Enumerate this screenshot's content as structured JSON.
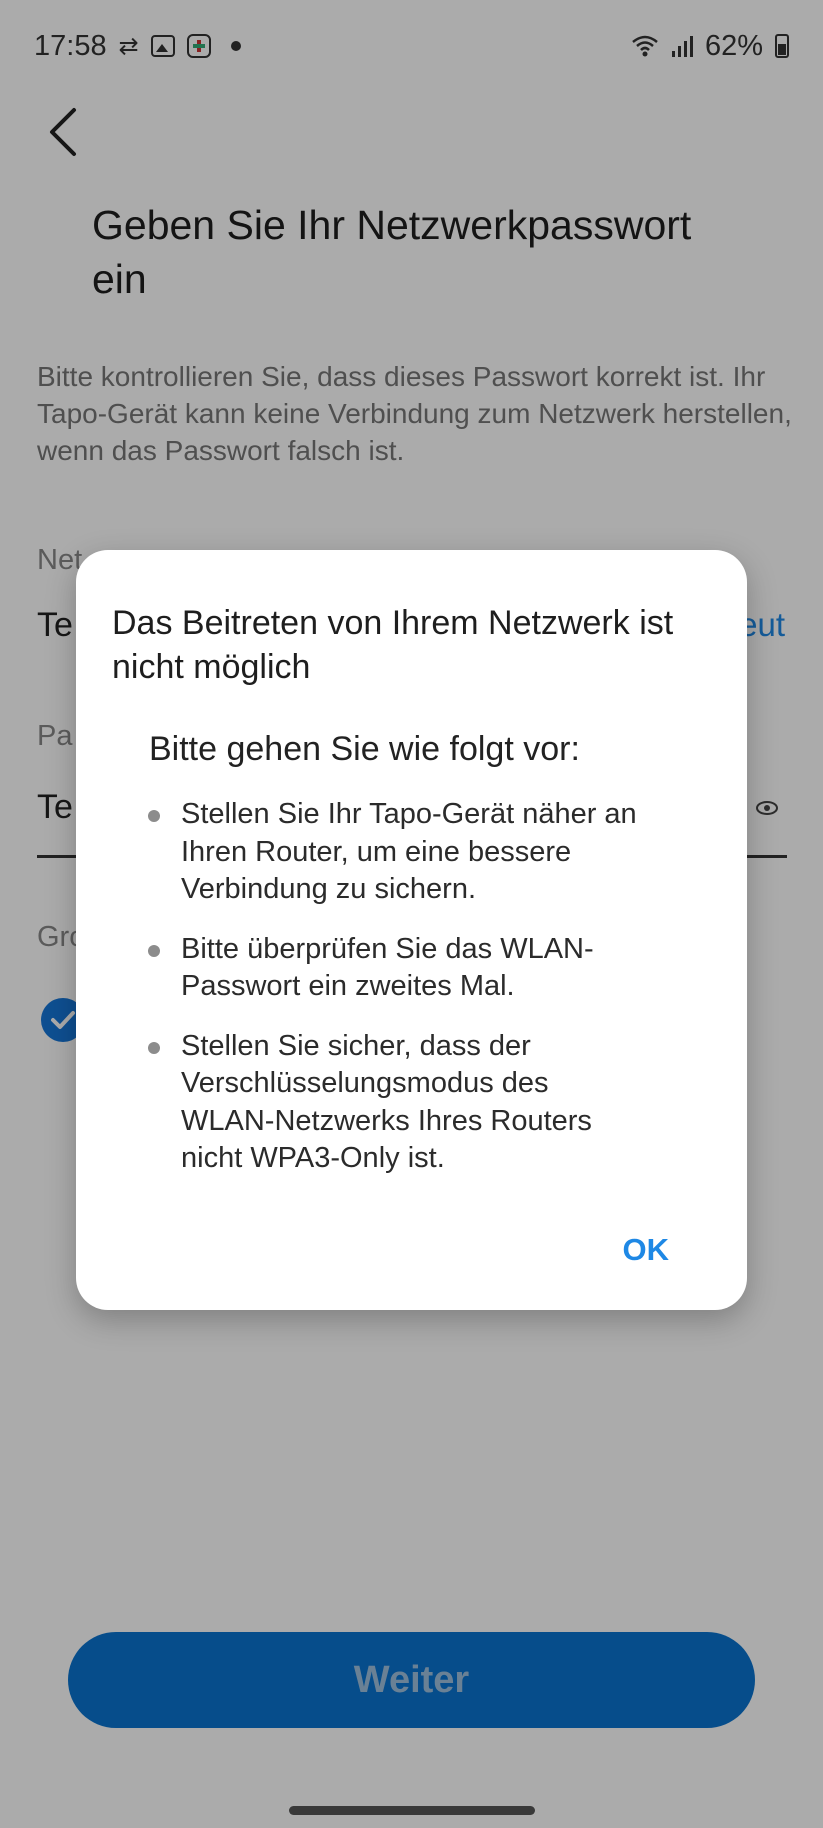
{
  "status_bar": {
    "time": "17:58",
    "battery": "62%",
    "icons": [
      "data-transfer-icon",
      "gallery-icon",
      "slack-icon",
      "dot-icon",
      "wifi-icon",
      "signal-icon",
      "battery-icon"
    ]
  },
  "page": {
    "title": "Geben Sie Ihr Netzwerkpasswort ein",
    "description": "Bitte kontrollieren Sie, dass dieses Passwort korrekt ist. Ihr Tapo-Gerät kann keine Verbindung zum Netzwerk herstellen, wenn das Passwort falsch ist.",
    "network_label_visible": "Net",
    "network_value_visible": "Te",
    "rescan_link_visible": "eut",
    "password_label_visible": "Pa",
    "password_value_visible": "Te",
    "group_label_visible": "Gro",
    "continue_button": "Weiter"
  },
  "dialog": {
    "title": "Das Beitreten von Ihrem Netzwerk ist nicht möglich",
    "heading": "Bitte gehen Sie wie folgt vor:",
    "tips": [
      "Stellen Sie Ihr Tapo-Gerät näher an Ihren Router, um eine bessere Verbindung zu sichern.",
      "Bitte überprüfen Sie das WLAN-Passwort ein zweites Mal.",
      "Stellen Sie sicher, dass der Verschlüsselungsmodus des WLAN-Netzwerks Ihres Routers nicht WPA3-Only ist."
    ],
    "ok_button": "OK"
  },
  "colors": {
    "accent": "#1e88e5",
    "primary_button": "#0a74cf",
    "scrim": "rgba(0,0,0,0.33)"
  }
}
